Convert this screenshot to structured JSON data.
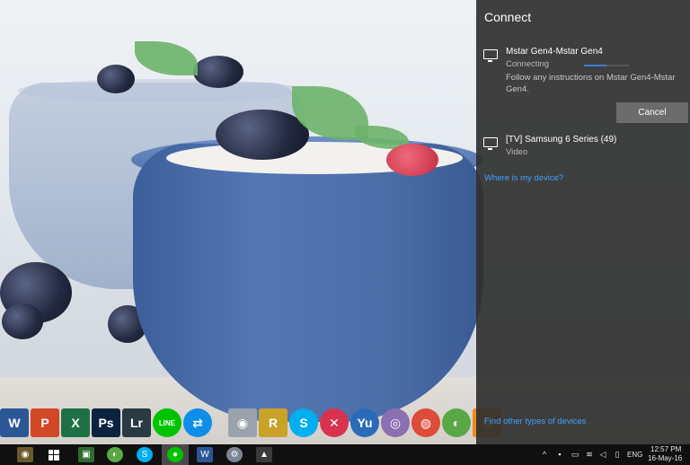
{
  "flyout": {
    "title": "Connect",
    "devices": [
      {
        "name": "Mstar Gen4-Mstar Gen4",
        "status": "Connecting",
        "note": "Follow any instructions on Mstar Gen4-Mstar Gen4.",
        "progress": 0.5
      },
      {
        "name": "[TV] Samsung 6 Series (49)",
        "status": "Video"
      }
    ],
    "cancel_label": "Cancel",
    "where_link": "Where is my device?",
    "other_link": "Find other types of devices"
  },
  "dock": {
    "apps": [
      {
        "label": "W",
        "icon": "word-icon",
        "color": "#2b5797"
      },
      {
        "label": "P",
        "icon": "powerpoint-icon",
        "color": "#d24726"
      },
      {
        "label": "X",
        "icon": "excel-icon",
        "color": "#1e7145"
      },
      {
        "label": "Ps",
        "icon": "photoshop-icon",
        "color": "#0c2340"
      },
      {
        "label": "Lr",
        "icon": "lightroom-icon",
        "color": "#2a3a42"
      },
      {
        "label": "LINE",
        "icon": "line-icon",
        "color": "#00c300"
      },
      {
        "label": "⇄",
        "icon": "teamviewer-icon",
        "color": "#0e8ee9"
      },
      {
        "label": "◉",
        "icon": "camera-icon",
        "color": "#9aa3ad"
      },
      {
        "label": "R",
        "icon": "winrar-icon",
        "color": "#c9a227"
      },
      {
        "label": "S",
        "icon": "skype-icon",
        "color": "#00aff0"
      },
      {
        "label": "✕",
        "icon": "app-red-icon",
        "color": "#d9324f"
      },
      {
        "label": "Yu",
        "icon": "yu-icon",
        "color": "#2a6bb8"
      },
      {
        "label": "◎",
        "icon": "disc-icon",
        "color": "#8a6fb1"
      },
      {
        "label": "◍",
        "icon": "chrome-icon",
        "color": "#dd4b39"
      },
      {
        "label": "◐",
        "icon": "coccoc-icon",
        "color": "#5aa845"
      },
      {
        "label": "G",
        "icon": "pdf-icon",
        "color": "#f08a1c"
      }
    ]
  },
  "taskbar": {
    "tray": {
      "lang": "ENG",
      "time": "12:57 PM",
      "date": "16-May-16"
    }
  },
  "colors": {
    "flyout_bg": "#303030",
    "link": "#3fa3ff",
    "taskbar_bg": "#101010"
  }
}
